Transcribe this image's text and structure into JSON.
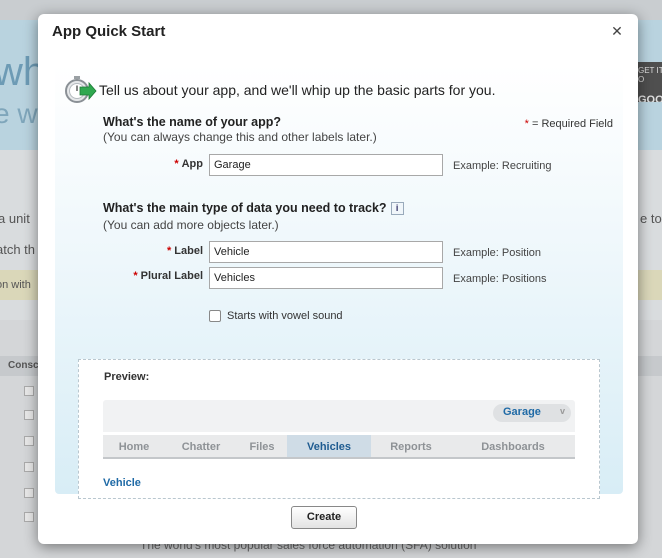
{
  "background": {
    "banner_big": "whe",
    "banner_sub": "e with",
    "promo_lines": [
      "GET IT O",
      "GOO"
    ],
    "text_line_1_left": "a unit",
    "text_line_1_right": "e to",
    "text_line_2_left": "atch th",
    "yellow_bar_text": "on with",
    "table_header": "Consc",
    "footer_text": "The world's most popular sales force automation (SFA) solution"
  },
  "dialog": {
    "title": "App Quick Start",
    "close_icon": "close-icon",
    "intro": "Tell us about your app, and we'll whip up the basic parts for you.",
    "required_note": "= Required Field",
    "required_star": "*",
    "app_section": {
      "question": "What's the name of your app?",
      "hint": "(You can always change this and other labels later.)",
      "app_label": "App",
      "app_value": "Garage",
      "app_example": "Example: Recruiting"
    },
    "data_section": {
      "question": "What's the main type of data you need to track?",
      "info_icon": "i",
      "hint": "(You can add more objects later.)",
      "label_label": "Label",
      "label_value": "Vehicle",
      "label_example": "Example: Position",
      "plural_label": "Plural Label",
      "plural_value": "Vehicles",
      "plural_example": "Example: Positions",
      "vowel_checkbox_label": "Starts with vowel sound",
      "vowel_checked": false
    },
    "preview": {
      "label": "Preview:",
      "app_name": "Garage",
      "app_chevron": "v",
      "tabs": [
        "Home",
        "Chatter",
        "Files",
        "Vehicles",
        "Reports",
        "Dashboards"
      ],
      "active_tab": "Vehicles",
      "object_name": "Vehicle"
    },
    "create_button": "Create"
  },
  "colors": {
    "link_blue": "#1f6aa6",
    "required_red": "#cc0000",
    "panel_gradient_bottom": "#d8edf6"
  }
}
